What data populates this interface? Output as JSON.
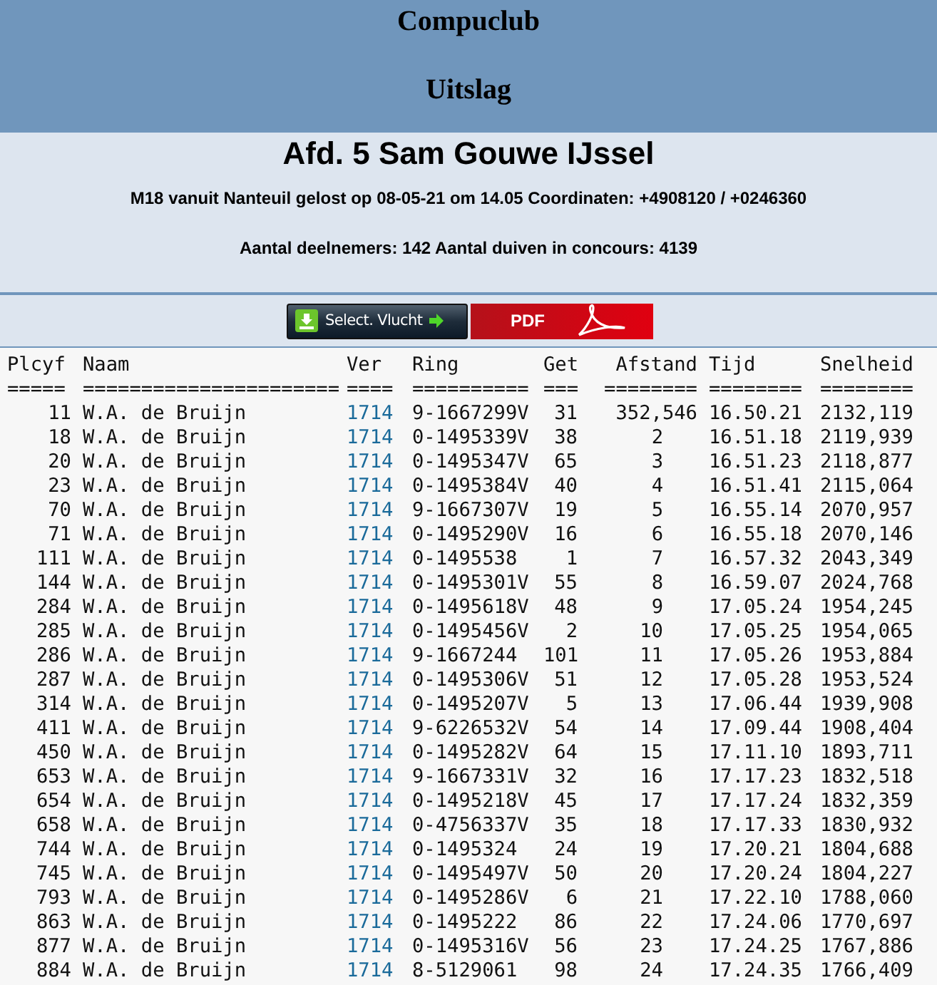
{
  "header": {
    "club": "Compuclub",
    "subtitle": "Uitslag"
  },
  "race": {
    "title": "Afd. 5 Sam Gouwe IJssel",
    "details": "M18 vanuit Nanteuil gelost op 08-05-21 om 14.05 Coordinaten: +4908120 / +0246360",
    "counts": "Aantal deelnemers: 142 Aantal duiven in concours: 4139"
  },
  "buttons": [
    {
      "kind": "select",
      "label": "Select. Vlucht"
    },
    {
      "kind": "pdf",
      "label": "PDF"
    }
  ],
  "table": {
    "columns": [
      {
        "label": "Plcyf",
        "rule": "====="
      },
      {
        "label": "Naam",
        "rule": "======================"
      },
      {
        "label": "Ver",
        "rule": "===="
      },
      {
        "label": "Ring",
        "rule": "=========="
      },
      {
        "label": "Get",
        "rule": "==="
      },
      {
        "label": "Afstand",
        "rule": "========"
      },
      {
        "label": "Tijd",
        "rule": "========"
      },
      {
        "label": "Snelheid",
        "rule": "========"
      }
    ],
    "rows": [
      [
        "11",
        "W.A. de Bruijn",
        "1714",
        "9-1667299V",
        "31",
        "352,546",
        "16.50.21",
        "2132,119"
      ],
      [
        "18",
        "W.A. de Bruijn",
        "1714",
        "0-1495339V",
        "38",
        "2",
        "16.51.18",
        "2119,939"
      ],
      [
        "20",
        "W.A. de Bruijn",
        "1714",
        "0-1495347V",
        "65",
        "3",
        "16.51.23",
        "2118,877"
      ],
      [
        "23",
        "W.A. de Bruijn",
        "1714",
        "0-1495384V",
        "40",
        "4",
        "16.51.41",
        "2115,064"
      ],
      [
        "70",
        "W.A. de Bruijn",
        "1714",
        "9-1667307V",
        "19",
        "5",
        "16.55.14",
        "2070,957"
      ],
      [
        "71",
        "W.A. de Bruijn",
        "1714",
        "0-1495290V",
        "16",
        "6",
        "16.55.18",
        "2070,146"
      ],
      [
        "111",
        "W.A. de Bruijn",
        "1714",
        "0-1495538",
        "1",
        "7",
        "16.57.32",
        "2043,349"
      ],
      [
        "144",
        "W.A. de Bruijn",
        "1714",
        "0-1495301V",
        "55",
        "8",
        "16.59.07",
        "2024,768"
      ],
      [
        "284",
        "W.A. de Bruijn",
        "1714",
        "0-1495618V",
        "48",
        "9",
        "17.05.24",
        "1954,245"
      ],
      [
        "285",
        "W.A. de Bruijn",
        "1714",
        "0-1495456V",
        "2",
        "10",
        "17.05.25",
        "1954,065"
      ],
      [
        "286",
        "W.A. de Bruijn",
        "1714",
        "9-1667244",
        "101",
        "11",
        "17.05.26",
        "1953,884"
      ],
      [
        "287",
        "W.A. de Bruijn",
        "1714",
        "0-1495306V",
        "51",
        "12",
        "17.05.28",
        "1953,524"
      ],
      [
        "314",
        "W.A. de Bruijn",
        "1714",
        "0-1495207V",
        "5",
        "13",
        "17.06.44",
        "1939,908"
      ],
      [
        "411",
        "W.A. de Bruijn",
        "1714",
        "9-6226532V",
        "54",
        "14",
        "17.09.44",
        "1908,404"
      ],
      [
        "450",
        "W.A. de Bruijn",
        "1714",
        "0-1495282V",
        "64",
        "15",
        "17.11.10",
        "1893,711"
      ],
      [
        "653",
        "W.A. de Bruijn",
        "1714",
        "9-1667331V",
        "32",
        "16",
        "17.17.23",
        "1832,518"
      ],
      [
        "654",
        "W.A. de Bruijn",
        "1714",
        "0-1495218V",
        "45",
        "17",
        "17.17.24",
        "1832,359"
      ],
      [
        "658",
        "W.A. de Bruijn",
        "1714",
        "0-4756337V",
        "35",
        "18",
        "17.17.33",
        "1830,932"
      ],
      [
        "744",
        "W.A. de Bruijn",
        "1714",
        "0-1495324",
        "24",
        "19",
        "17.20.21",
        "1804,688"
      ],
      [
        "745",
        "W.A. de Bruijn",
        "1714",
        "0-1495497V",
        "50",
        "20",
        "17.20.24",
        "1804,227"
      ],
      [
        "793",
        "W.A. de Bruijn",
        "1714",
        "0-1495286V",
        "6",
        "21",
        "17.22.10",
        "1788,060"
      ],
      [
        "863",
        "W.A. de Bruijn",
        "1714",
        "0-1495222",
        "86",
        "22",
        "17.24.06",
        "1770,697"
      ],
      [
        "877",
        "W.A. de Bruijn",
        "1714",
        "0-1495316V",
        "56",
        "23",
        "17.24.25",
        "1767,886"
      ],
      [
        "884",
        "W.A. de Bruijn",
        "1714",
        "8-5129061",
        "98",
        "24",
        "17.24.35",
        "1766,409"
      ]
    ]
  }
}
